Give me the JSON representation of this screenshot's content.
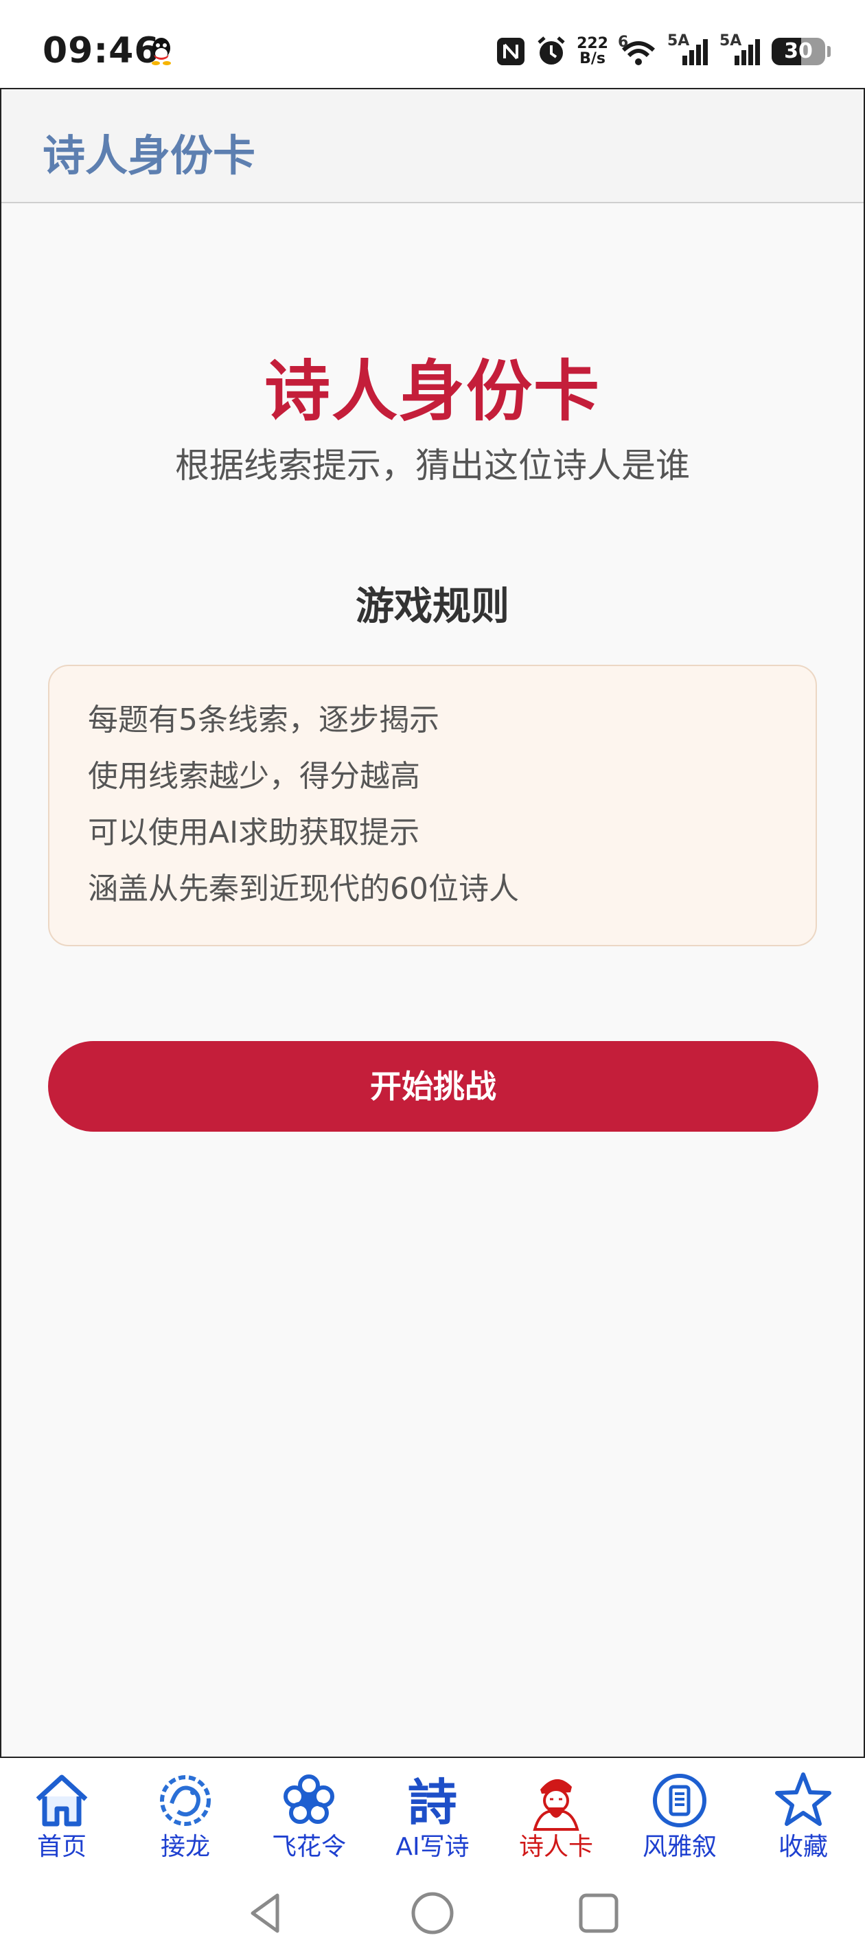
{
  "status_bar": {
    "time": "09:46",
    "net_speed_value": "222",
    "net_speed_unit": "B/s",
    "wifi_label": "6",
    "signal1_label": "5A",
    "signal2_label": "5A",
    "battery": "30",
    "icons": [
      "qq-icon",
      "nfc-icon",
      "alarm-icon",
      "wifi-icon",
      "signal-icon",
      "signal-icon",
      "battery-icon"
    ]
  },
  "app_bar": {
    "title": "诗人身份卡"
  },
  "hero": {
    "title": "诗人身份卡",
    "subtitle": "根据线索提示，猜出这位诗人是谁"
  },
  "rules": {
    "title": "游戏规则",
    "items": [
      "每题有5条线索，逐步揭示",
      "使用线索越少，得分越高",
      "可以使用AI求助获取提示",
      "涵盖从先秦到近现代的60位诗人"
    ]
  },
  "start_button": {
    "label": "开始挑战"
  },
  "bottom_nav": {
    "items": [
      {
        "label": "首页",
        "icon": "home-icon"
      },
      {
        "label": "接龙",
        "icon": "dragon-icon"
      },
      {
        "label": "飞花令",
        "icon": "flower-icon"
      },
      {
        "label": "AI写诗",
        "icon": "poem-icon"
      },
      {
        "label": "诗人卡",
        "icon": "poet-portrait-icon",
        "active": true
      },
      {
        "label": "风雅叙",
        "icon": "scroll-icon"
      },
      {
        "label": "收藏",
        "icon": "star-icon"
      }
    ]
  },
  "system_nav": {
    "icons": [
      "back-icon",
      "home-circle-icon",
      "recents-icon"
    ]
  },
  "colors": {
    "accent": "#c41e3a",
    "appbar_title": "#5d7fb0",
    "nav_label": "#1e40d0",
    "nav_active": "#d01818",
    "rules_bg": "#fdf5ee"
  }
}
